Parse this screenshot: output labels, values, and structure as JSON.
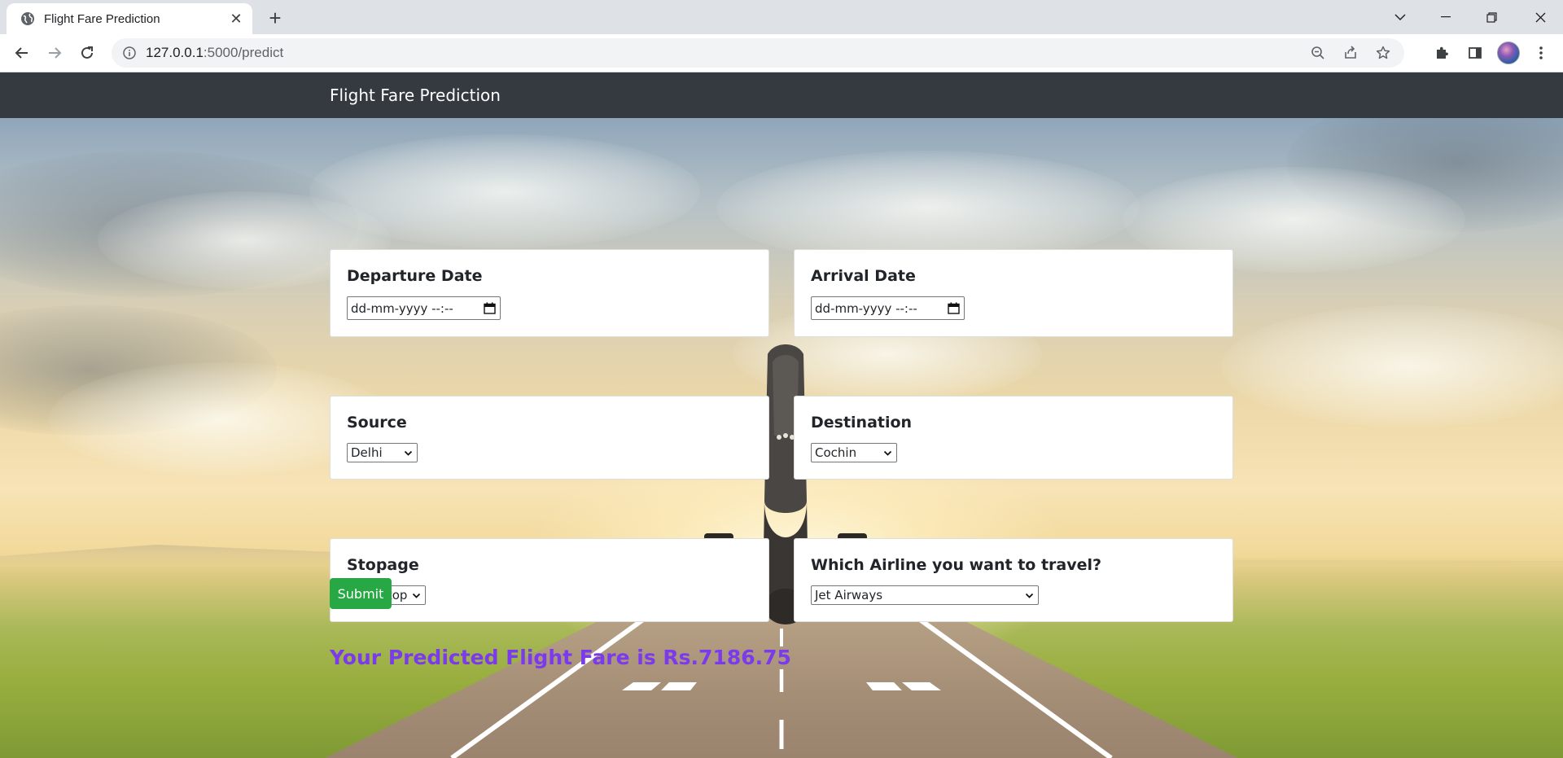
{
  "browser": {
    "tab_title": "Flight Fare Prediction",
    "url_host": "127.0.0.1",
    "url_path": ":5000/predict"
  },
  "navbar": {
    "brand": "Flight Fare Prediction"
  },
  "form": {
    "departure": {
      "label": "Departure Date",
      "placeholder": "dd-mm-yyyy --:--"
    },
    "arrival": {
      "label": "Arrival Date",
      "placeholder": "dd-mm-yyyy --:--"
    },
    "source": {
      "label": "Source",
      "value": "Delhi"
    },
    "destination": {
      "label": "Destination",
      "value": "Cochin"
    },
    "stopage": {
      "label": "Stopage",
      "value": "Non-Stop"
    },
    "airline": {
      "label": "Which Airline you want to travel?",
      "value": "Jet Airways"
    },
    "submit_label": "Submit"
  },
  "result": {
    "text": "Your Predicted Flight Fare is Rs.7186.75"
  },
  "colors": {
    "navbar": "#343a40",
    "submit": "#28a745",
    "result": "#7c3aed"
  }
}
